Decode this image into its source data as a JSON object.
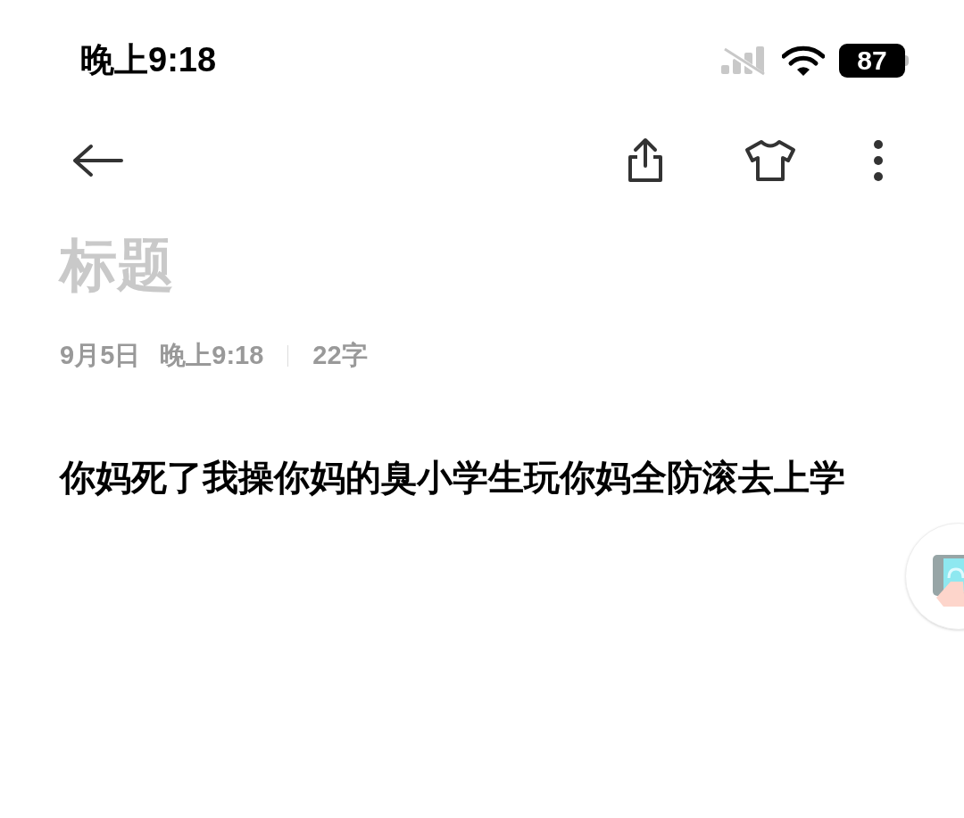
{
  "status_bar": {
    "time": "晚上9:18",
    "battery": "87"
  },
  "toolbar": {
    "kind": "note-editor"
  },
  "note": {
    "title_placeholder": "标题",
    "date": "9月5日",
    "time": "晚上9:18",
    "word_count": "22字",
    "body": "你妈死了我操你妈的臭小学生玩你妈全防滚去上学"
  }
}
